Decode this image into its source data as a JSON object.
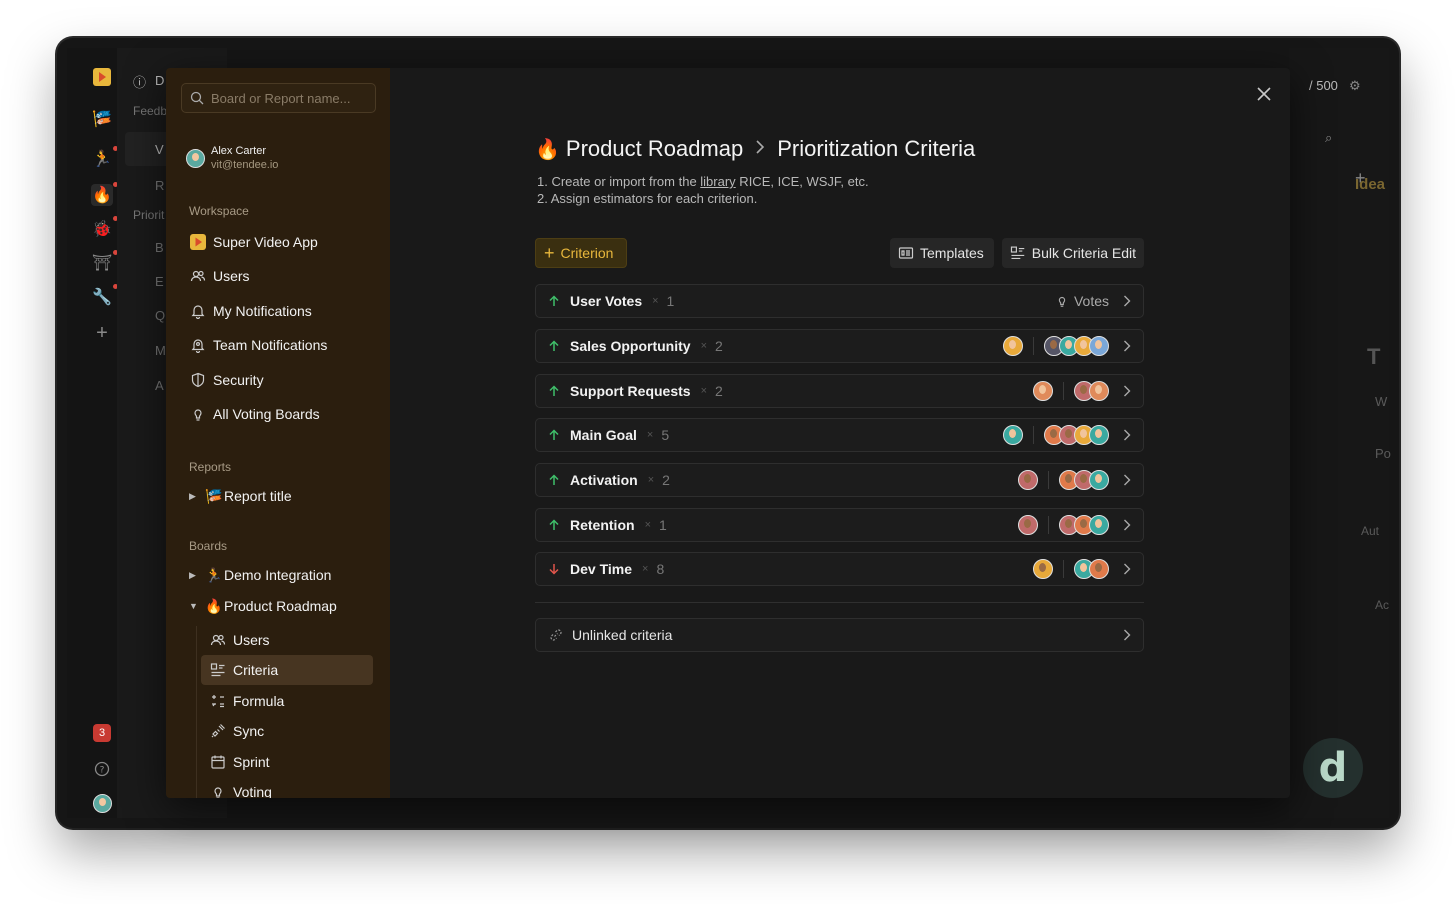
{
  "background": {
    "sidebar_labels": [
      "Feedb",
      "V",
      "R",
      "Priorit",
      "B",
      "E",
      "Q",
      "M",
      "A"
    ],
    "top_counter": "/ 500",
    "notification_count": "3",
    "right_texts": [
      "Idea",
      "T",
      "W",
      "Po",
      "Aut",
      "Ac"
    ],
    "logo_letter": "d"
  },
  "search": {
    "placeholder": "Board or Report name..."
  },
  "user": {
    "name": "Alex Carter",
    "email": "vit@tendee.io"
  },
  "workspace": {
    "label": "Workspace",
    "items": [
      {
        "label": "Super Video App",
        "icon": "app-logo-icon"
      },
      {
        "label": "Users",
        "icon": "users-icon"
      },
      {
        "label": "My Notifications",
        "icon": "bell-icon"
      },
      {
        "label": "Team Notifications",
        "icon": "team-bell-icon"
      },
      {
        "label": "Security",
        "icon": "shield-icon"
      },
      {
        "label": "All Voting Boards",
        "icon": "lightbulb-icon"
      }
    ]
  },
  "reports": {
    "label": "Reports",
    "items": [
      {
        "label": "Report title",
        "icon": "flag-emoji-icon"
      }
    ]
  },
  "boards": {
    "label": "Boards",
    "items": [
      {
        "label": "Demo Integration",
        "icon": "runner-emoji-icon",
        "expanded": false
      },
      {
        "label": "Product Roadmap",
        "icon": "fire-emoji-icon",
        "expanded": true
      }
    ],
    "subitems": [
      {
        "label": "Users",
        "icon": "users-icon"
      },
      {
        "label": "Criteria",
        "icon": "criteria-icon",
        "active": true
      },
      {
        "label": "Formula",
        "icon": "formula-icon"
      },
      {
        "label": "Sync",
        "icon": "plug-icon"
      },
      {
        "label": "Sprint",
        "icon": "calendar-icon"
      },
      {
        "label": "Voting",
        "icon": "lightbulb-icon"
      }
    ]
  },
  "header": {
    "emoji": "🔥",
    "board": "Product Roadmap",
    "page": "Prioritization Criteria",
    "step1_pre": "1. Create or import from the ",
    "step1_link": "library",
    "step1_post": " RICE, ICE, WSJF, etc.",
    "step2": "2. Assign estimators for each criterion."
  },
  "toolbar": {
    "add_label": "Criterion",
    "templates_label": "Templates",
    "bulk_label": "Bulk Criteria Edit"
  },
  "criteria": [
    {
      "name": "User Votes",
      "weight": "1",
      "direction": "up",
      "votes_label": "Votes"
    },
    {
      "name": "Sales Opportunity",
      "weight": "2",
      "direction": "up"
    },
    {
      "name": "Support Requests",
      "weight": "2",
      "direction": "up"
    },
    {
      "name": "Main Goal",
      "weight": "5",
      "direction": "up"
    },
    {
      "name": "Activation",
      "weight": "2",
      "direction": "up"
    },
    {
      "name": "Retention",
      "weight": "1",
      "direction": "up"
    },
    {
      "name": "Dev Time",
      "weight": "8",
      "direction": "down"
    }
  ],
  "multiplier": "×",
  "unlinked": {
    "label": "Unlinked criteria"
  },
  "colors": {
    "accent": "#e8b73c",
    "up": "#3fbf6a",
    "down": "#e0554b",
    "sidebar_bg": "#2b1e0e"
  }
}
